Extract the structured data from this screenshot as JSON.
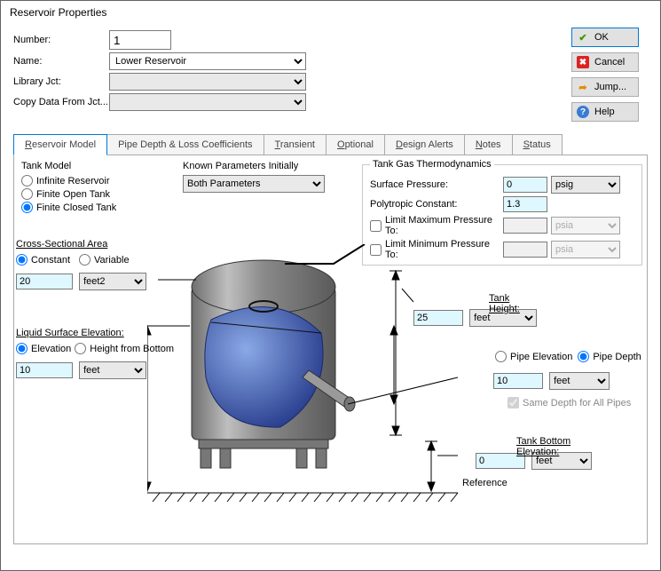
{
  "window_title": "Reservoir Properties",
  "form": {
    "number_label": "Number:",
    "number_value": "1",
    "name_label": "Name:",
    "name_value": "Lower Reservoir",
    "library_label": "Library Jct:",
    "copy_label": "Copy Data From Jct..."
  },
  "buttons": {
    "ok": "OK",
    "cancel": "Cancel",
    "jump": "Jump...",
    "help": "Help"
  },
  "tabs": {
    "model": "eservoir Model",
    "model_u": "R",
    "pipe": "Pipe Depth & Loss Coefficients",
    "transient": "ransient",
    "transient_u": "T",
    "optional": "ptional",
    "optional_u": "O",
    "alerts": "esign Alerts",
    "alerts_u": "D",
    "notes": "otes",
    "notes_u": "N",
    "status": "tatus",
    "status_u": "S"
  },
  "tank_model": {
    "title": "Tank Model",
    "opt_infinite": "Infinite Reservoir",
    "opt_open": "Finite Open Tank",
    "opt_closed": "Finite Closed Tank"
  },
  "known_params": {
    "title": "Known Parameters Initially",
    "value": "Both Parameters"
  },
  "thermo": {
    "title": "Tank Gas Thermodynamics",
    "surf_press": "Surface Pressure:",
    "surf_press_val": "0",
    "surf_press_unit": "psig",
    "poly": "Polytropic Constant:",
    "poly_val": "1.3",
    "limit_max": "Limit Maximum Pressure To:",
    "limit_min": "Limit Minimum Pressure To:",
    "psia": "psia"
  },
  "cross_section": {
    "title": "Cross-Sectional Area",
    "constant": "Constant",
    "variable": "Variable",
    "value": "20",
    "unit": "feet2"
  },
  "surface_elev": {
    "title": "Liquid Surface Elevation:",
    "elevation": "Elevation",
    "height": "Height from Bottom",
    "value": "10",
    "unit": "feet"
  },
  "tank_height": {
    "title": "Tank Height:",
    "value": "25",
    "unit": "feet"
  },
  "pipe": {
    "elev": "Pipe Elevation",
    "depth": "Pipe Depth",
    "value": "10",
    "unit": "feet",
    "same": "Same Depth for All Pipes"
  },
  "bottom_elev": {
    "title": "Tank Bottom Elevation:",
    "value": "0",
    "unit": "feet"
  },
  "reference": "Reference"
}
